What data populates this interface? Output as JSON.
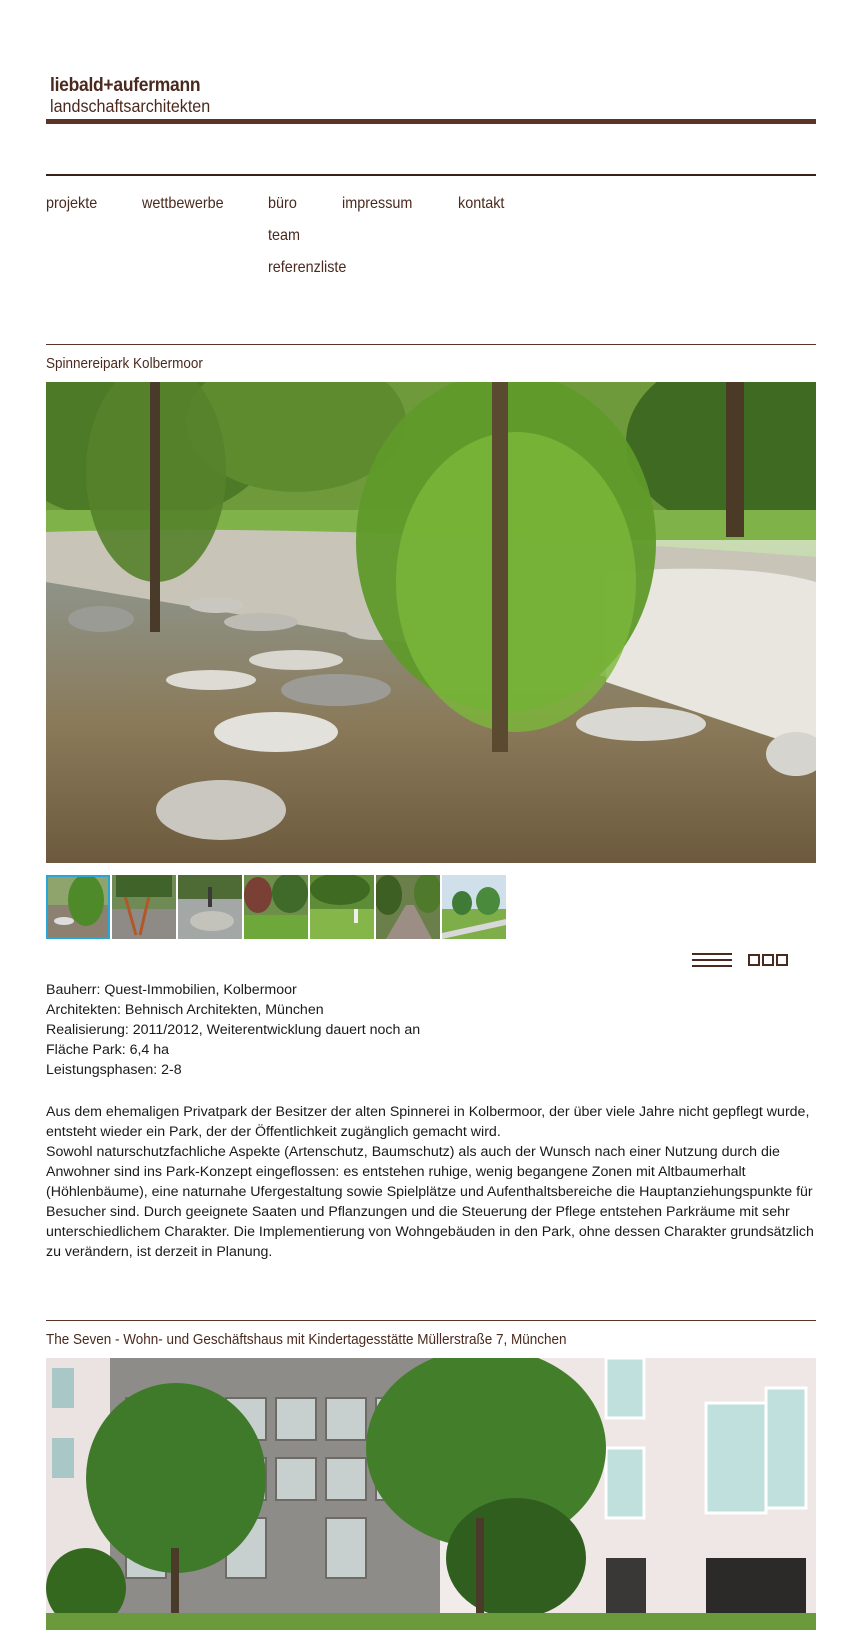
{
  "header": {
    "logo_line1": "liebald+aufermann",
    "logo_line2": "landschaftsarchitekten"
  },
  "nav": {
    "projekte": "projekte",
    "wettbewerbe": "wettbewerbe",
    "buero": "büro",
    "team": "team",
    "referenzliste": "referenzliste",
    "impressum": "impressum",
    "kontakt": "kontakt"
  },
  "project1": {
    "title": "Spinnereipark Kolbermoor",
    "thumbnail_count": 7,
    "active_thumbnail": 1,
    "meta": [
      "Bauherr: Quest-Immobilien, Kolbermoor",
      "Architekten: Behnisch Architekten, München",
      "Realisierung: 2011/2012, Weiterentwicklung dauert noch an",
      "Fläche Park: 6,4 ha",
      "Leistungsphasen: 2-8"
    ],
    "description": [
      "Aus dem ehemaligen Privatpark der Besitzer der alten Spinnerei in Kolbermoor, der über viele Jahre nicht gepflegt wurde, entsteht wieder ein Park, der der Öffentlichkeit zugänglich gemacht wird.",
      "Sowohl naturschutzfachliche Aspekte (Artenschutz, Baumschutz) als auch der Wunsch nach einer Nutzung durch die Anwohner sind ins Park-Konzept eingeflossen: es entstehen ruhige, wenig begangene Zonen mit Altbaumerhalt (Höhlenbäume), eine naturnahe Ufergestaltung sowie Spielplätze und Aufenthaltsbereiche die Hauptanziehungspunkte für Besucher sind. Durch geeignete Saaten und Pflanzungen und die Steuerung der Pflege entstehen Parkräume mit sehr unterschiedlichem Charakter. Die Implementierung von Wohngebäuden in den Park, ohne dessen Charakter grundsätzlich zu verändern, ist derzeit in Planung."
    ]
  },
  "project2": {
    "title": "The Seven - Wohn- und Geschäftshaus mit Kindertagesstätte Müllerstraße 7, München"
  },
  "icons": {
    "list_view": "list-view-icon",
    "grid_view": "grid-view-icon"
  },
  "colors": {
    "brand_brown": "#4a2a1e",
    "rule_brown": "#5a3426",
    "thumb_active": "#2aa5d8"
  }
}
